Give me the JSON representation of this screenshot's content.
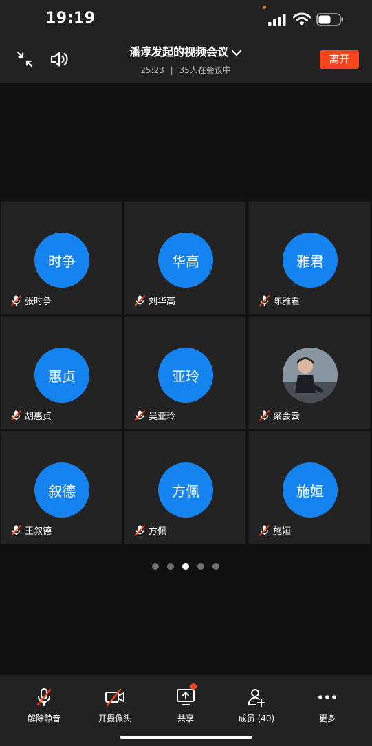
{
  "status": {
    "time": "19:19"
  },
  "header": {
    "title": "潘淳发起的视频会议",
    "duration": "25:23",
    "separator": "|",
    "participants": "35人在会议中",
    "leave_label": "离开"
  },
  "tiles": [
    {
      "avatar_text": "时争",
      "name": "张时争"
    },
    {
      "avatar_text": "华高",
      "name": "刘华高"
    },
    {
      "avatar_text": "雅君",
      "name": "陈雅君"
    },
    {
      "avatar_text": "惠贞",
      "name": "胡惠贞"
    },
    {
      "avatar_text": "亚玲",
      "name": "吴亚玲"
    },
    {
      "avatar_text": "",
      "name": "梁会云"
    },
    {
      "avatar_text": "叙德",
      "name": "王叙德"
    },
    {
      "avatar_text": "方佩",
      "name": "方佩"
    },
    {
      "avatar_text": "施姮",
      "name": "施姮"
    }
  ],
  "pager": {
    "count": 5,
    "active_index": 2
  },
  "toolbar": {
    "unmute": "解除静音",
    "camera": "开摄像头",
    "share": "共享",
    "members": "成员 (40)",
    "more": "更多"
  },
  "colors": {
    "accent": "#1583f0",
    "leave": "#f5451e",
    "background": "#111111",
    "panel": "#222222"
  }
}
